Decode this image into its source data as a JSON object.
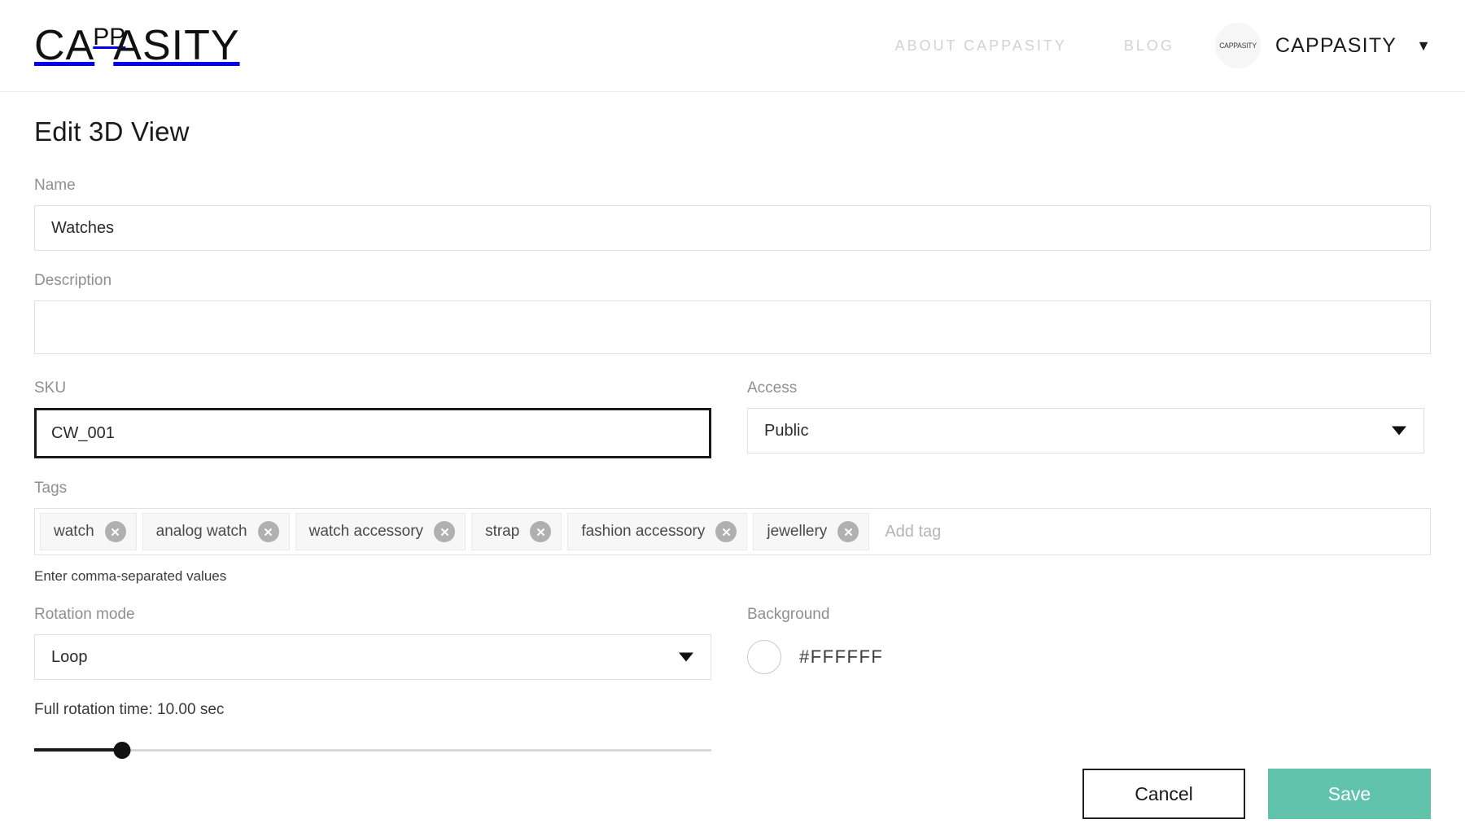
{
  "header": {
    "logo": {
      "part1": "CA",
      "part2": "PP",
      "part3": "ASITY",
      "name": "CAPPASITY"
    },
    "nav": [
      {
        "label": "ABOUT CAPPASITY",
        "name": "nav-about-cappasity"
      },
      {
        "label": "BLOG",
        "name": "nav-blog"
      }
    ],
    "avatar_text": "CAPPASITY",
    "user_name": "CAPPASITY",
    "caret": "▼"
  },
  "page": {
    "title": "Edit 3D View"
  },
  "form": {
    "name": {
      "label": "Name",
      "value": "Watches",
      "placeholder": ""
    },
    "description": {
      "label": "Description",
      "value": "",
      "placeholder": ""
    },
    "sku": {
      "label": "SKU",
      "value": "CW_001",
      "placeholder": "",
      "focused": true
    },
    "access": {
      "label": "Access",
      "value": "Public",
      "options": [
        "Public"
      ]
    },
    "tags": {
      "label": "Tags",
      "items": [
        {
          "label": "watch"
        },
        {
          "label": "analog watch"
        },
        {
          "label": "watch accessory"
        },
        {
          "label": "strap"
        },
        {
          "label": "fashion accessory"
        },
        {
          "label": "jewellery"
        }
      ],
      "add_placeholder": "Add tag",
      "helper": "Enter comma-separated values"
    },
    "rotation_mode": {
      "label": "Rotation mode",
      "value": "Loop",
      "options": [
        "Loop"
      ]
    },
    "background": {
      "label": "Background",
      "hex": "#FFFFFF",
      "swatch_color": "#FFFFFF"
    },
    "rotation_time": {
      "label": "Full rotation time: 10.00 sec",
      "value_percent": 13
    }
  },
  "actions": {
    "cancel_label": "Cancel",
    "save_label": "Save",
    "save_color": "#62C3AD"
  }
}
